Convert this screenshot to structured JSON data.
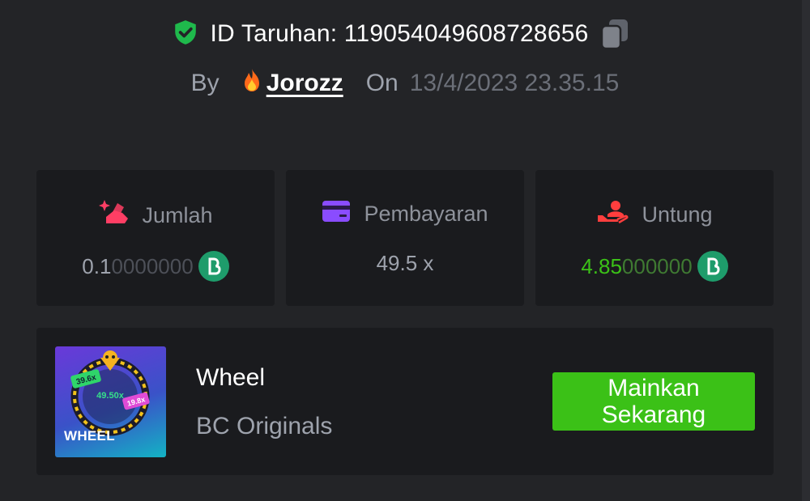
{
  "bet": {
    "id_label": "ID Taruhan: 1190540496087286​56",
    "by_label": "By",
    "username": "Jorozz",
    "on_label": "On",
    "date": "13/4/2023 23.35.15"
  },
  "stats": [
    {
      "label": "Jumlah",
      "value_bright": "0.1",
      "value_dim": "0000000",
      "icon": "amount-icon",
      "coin": true
    },
    {
      "label": "Pembayaran",
      "value_bright": "49.5 x",
      "value_dim": "",
      "icon": "card-icon",
      "coin": false
    },
    {
      "label": "Untung",
      "value_bright": "4.85",
      "value_dim": "000000",
      "icon": "profit-hand-icon",
      "coin": true
    }
  ],
  "game": {
    "name": "Wheel",
    "provider": "BC Originals",
    "thumb_caption": "WHEEL",
    "thumb_badges": [
      "39.6x",
      "49.50x",
      "19.8x"
    ],
    "play_button": "Mainkan Sekarang"
  },
  "colors": {
    "accent_green": "#3bc117",
    "shield_green": "#1fb94c",
    "coin_green": "#1e9c6b"
  }
}
